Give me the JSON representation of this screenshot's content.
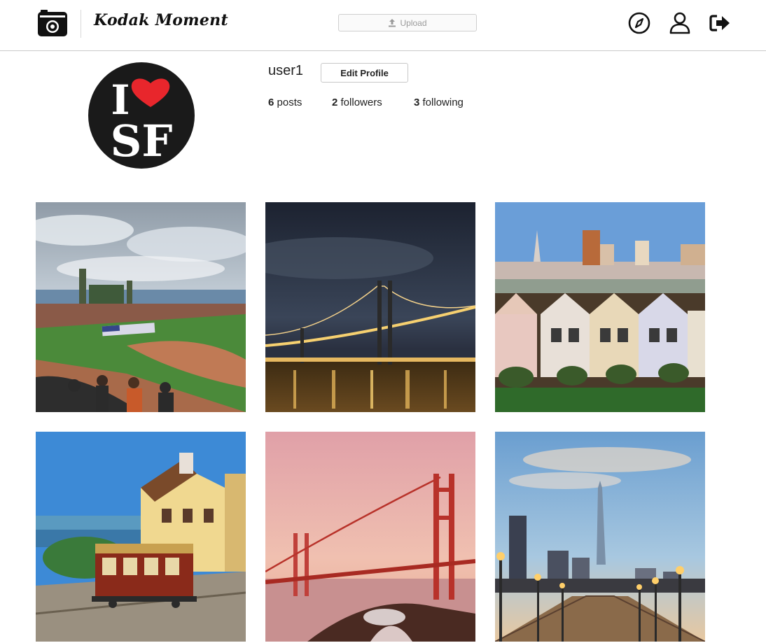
{
  "header": {
    "brand": "Kodak Moment",
    "upload_label": "Upload",
    "nav": [
      "compass-icon",
      "user-icon",
      "logout-icon"
    ]
  },
  "profile": {
    "username": "user1",
    "edit_label": "Edit Profile",
    "avatar_text_top": "I",
    "avatar_text_bottom": "SF",
    "stats": {
      "posts_count": "6",
      "posts_label": "posts",
      "followers_count": "2",
      "followers_label": "followers",
      "following_count": "3",
      "following_label": "following"
    }
  },
  "posts": [
    {
      "subject": "ballpark"
    },
    {
      "subject": "bay-bridge-night"
    },
    {
      "subject": "painted-ladies"
    },
    {
      "subject": "cable-car"
    },
    {
      "subject": "golden-gate-sunset"
    },
    {
      "subject": "pier-skyline"
    }
  ],
  "colors": {
    "accent": "#e8262c",
    "border": "#c9c9c9",
    "text": "#111111"
  }
}
